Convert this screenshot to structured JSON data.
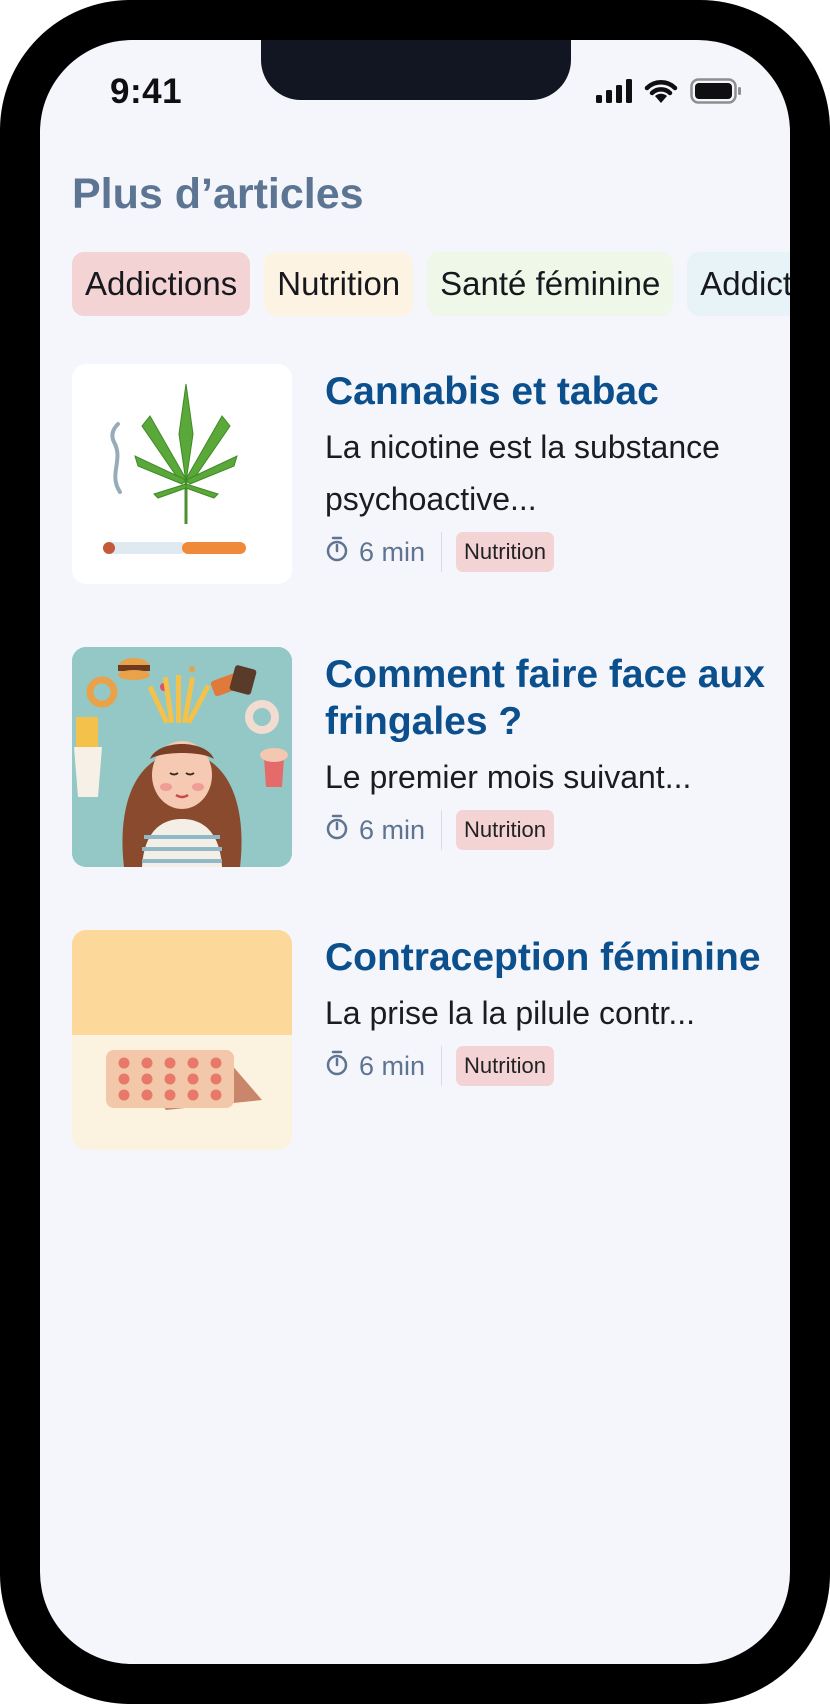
{
  "status_bar": {
    "time": "9:41"
  },
  "page": {
    "title": "Plus d’articles"
  },
  "chips": [
    {
      "label": "Addictions",
      "color": "#f4d3d4"
    },
    {
      "label": "Nutrition",
      "color": "#fdf3e2"
    },
    {
      "label": "Santé féminine",
      "color": "#eef7e8"
    },
    {
      "label": "Addictions",
      "color": "#e8f3f8"
    }
  ],
  "articles": [
    {
      "title": "Cannabis et tabac",
      "description": "La nicotine est la substance psychoactive...",
      "read_time": "6 min",
      "tag": "Nutrition",
      "image_icon": "cannabis-cigarette-illustration"
    },
    {
      "title": "Comment faire face aux fringales ?",
      "description": "Le premier mois suivant...",
      "read_time": "6 min",
      "tag": "Nutrition",
      "image_icon": "woman-junk-food-illustration"
    },
    {
      "title": "Contraception féminine",
      "description": "La prise la la pilule contr...",
      "read_time": "6 min",
      "tag": "Nutrition",
      "image_icon": "pill-pack-illustration"
    }
  ],
  "colors": {
    "title": "#5c7593",
    "article_title": "#0b4f8c",
    "meta": "#5e7490",
    "tag_bg": "#f4d3d4",
    "screen_bg": "#f5f6fc"
  }
}
